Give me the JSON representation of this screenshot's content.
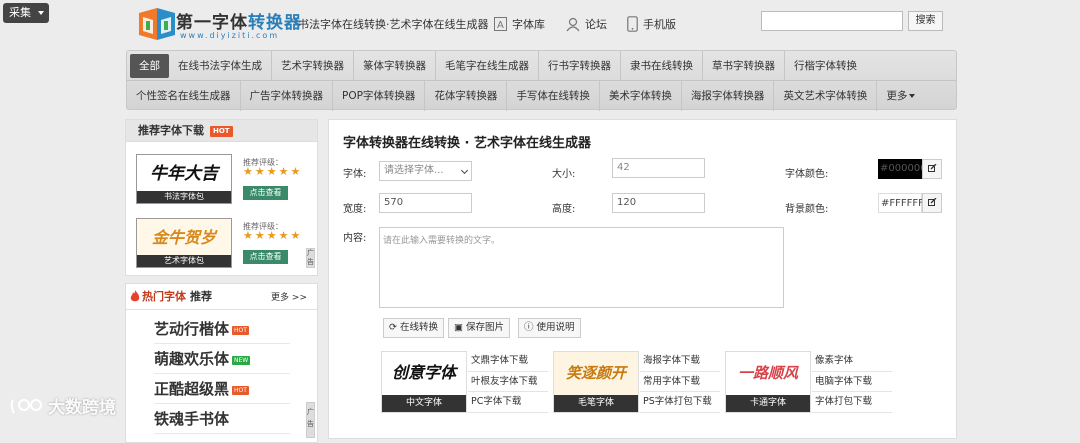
{
  "header": {
    "collect_label": "采集",
    "logo_title_a": "第一字体",
    "logo_title_b": "转换器",
    "logo_url": "www.diyiziti.com",
    "tagline": "书法字体在线转换·艺术字体在线生成器",
    "links": [
      {
        "label": "字体库",
        "icon": "font-library-icon"
      },
      {
        "label": "论坛",
        "icon": "user-icon"
      },
      {
        "label": "手机版",
        "icon": "mobile-icon"
      }
    ],
    "search_button": "搜索"
  },
  "nav": {
    "row1": [
      "全部",
      "在线书法字体生成",
      "艺术字转换器",
      "篆体字转换器",
      "毛笔字在线生成器",
      "行书字转换器",
      "隶书在线转换",
      "草书字转换器",
      "行楷字体转换"
    ],
    "row2": [
      "个性签名在线生成器",
      "广告字体转换器",
      "POP字体转换器",
      "花体字转换器",
      "手写体在线转换",
      "美术字体转换",
      "海报字体转换器",
      "英文艺术字体转换"
    ],
    "more_label": "更多"
  },
  "recommend": {
    "title": "推荐字体下载",
    "badge": "HOT",
    "rating_label": "推荐评级：",
    "stars": "★★★★★",
    "view_label": "点击查看",
    "items": [
      {
        "art": "牛年大吉",
        "caption": "书法字体包"
      },
      {
        "art": "金牛贺岁",
        "caption": "艺术字体包"
      }
    ],
    "side_tab": "广告"
  },
  "hot_fonts": {
    "title_a": "热门字体",
    "title_b": "推荐",
    "more": "更多 >>",
    "items": [
      {
        "name": "艺动行楷体",
        "tag": "HOT",
        "tag_color": "#e85a2c"
      },
      {
        "name": "萌趣欢乐体",
        "tag": "NEW",
        "tag_color": "#2aa845"
      },
      {
        "name": "正酷超级黑",
        "tag": "HOT",
        "tag_color": "#e85a2c"
      },
      {
        "name": "铁魂手书体",
        "tag": "",
        "tag_color": "#e85a2c"
      }
    ],
    "side_tab": "广告"
  },
  "converter": {
    "title": "字体转换器在线转换 · 艺术字体在线生成器",
    "font_label": "字体:",
    "font_placeholder": "请选择字体...",
    "size_label": "大小:",
    "size_value": "42",
    "font_color_label": "字体颜色:",
    "font_color_value": "#000000",
    "width_label": "宽度:",
    "width_value": "570",
    "height_label": "高度:",
    "height_value": "120",
    "bg_color_label": "背景颜色:",
    "bg_color_value": "#FFFFFF",
    "content_label": "内容:",
    "content_placeholder": "请在此输入需要转换的文字。",
    "convert_label": "在线转换",
    "save_label": "保存图片",
    "help_label": "使用说明",
    "categories": [
      {
        "art": "创意字体",
        "caption": "中文字体",
        "links": [
          "文鼎字体下载",
          "叶根友字体下载",
          "PC字体下载"
        ]
      },
      {
        "art": "笑逐颜开",
        "caption": "毛笔字体",
        "links": [
          "海报字体下载",
          "常用字体下载",
          "PS字体打包下载"
        ]
      },
      {
        "art": "一路顺风",
        "caption": "卡通字体",
        "links": [
          "像素字体",
          "电脑字体下载",
          "字体打包下载"
        ]
      }
    ]
  },
  "watermark": "大数跨境"
}
